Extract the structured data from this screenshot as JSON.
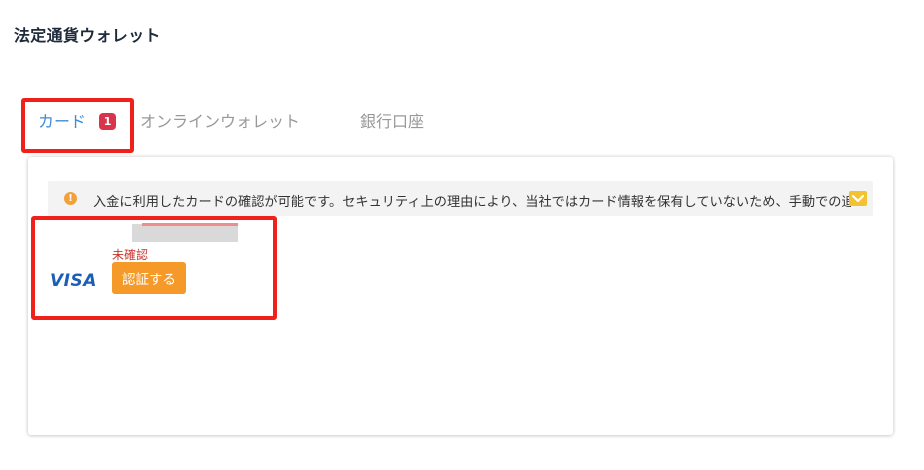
{
  "page": {
    "title": "法定通貨ウォレット"
  },
  "tabs": [
    {
      "label": "カード",
      "badge": "1",
      "active": true
    },
    {
      "label": "オンラインウォレット",
      "active": false
    },
    {
      "label": "銀行口座",
      "active": false
    }
  ],
  "notice": {
    "icon": "info-icon",
    "text": "入金に利用したカードの確認が可能です。セキュリティ上の理由により、当社ではカード情報を保有していないため、手動での追"
  },
  "card": {
    "brand": "VISA",
    "status": "未確認",
    "verify_label": "認証する"
  },
  "colors": {
    "accent": "#3f8bd6",
    "badge": "#d8344b",
    "verify_button": "#f59a28",
    "status_unverified": "#c8332a",
    "highlight": "#f0201a"
  }
}
